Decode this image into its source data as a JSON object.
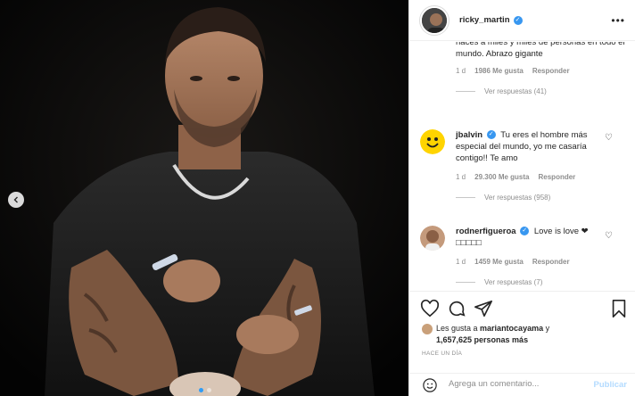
{
  "post": {
    "author": "ricky_martin",
    "carousel": {
      "current": 1,
      "total": 2
    }
  },
  "comments": [
    {
      "text": "hacés a miles y miles de personas en todo el mundo. Abrazo gigante",
      "age": "1 d",
      "likes": "1986 Me gusta",
      "reply_label": "Responder",
      "view_replies": "Ver respuestas (41)"
    },
    {
      "username": "jbalvin",
      "text": "Tu eres el hombre más especial del mundo, yo me casaría contigo!! Te amo",
      "age": "1 d",
      "likes": "29.300 Me gusta",
      "reply_label": "Responder",
      "view_replies": "Ver respuestas (958)"
    },
    {
      "username": "rodnerfigueroa",
      "text": "Love is love ❤ □□□□□",
      "age": "1 d",
      "likes": "1459 Me gusta",
      "reply_label": "Responder",
      "view_replies": "Ver respuestas (7)"
    }
  ],
  "likes_line1_prefix": "Les gusta a ",
  "likes_user": "mariantocayama",
  "likes_line1_suffix": " y",
  "likes_line2": "1,657,625 personas más",
  "timestamp": "HACE UN DÍA",
  "comment_box": {
    "placeholder": "Agrega un comentario...",
    "publish": "Publicar"
  },
  "icons": {
    "like": "heart-icon",
    "comment": "comment-icon",
    "share": "share-icon",
    "save": "bookmark-icon",
    "emoji": "emoji-icon",
    "more": "more-icon",
    "prev": "chevron-left-icon",
    "verified": "verified-badge-icon"
  },
  "colors": {
    "accent": "#3897f0",
    "publish_disabled": "#b3dbff",
    "muted": "#8e8e8e"
  }
}
